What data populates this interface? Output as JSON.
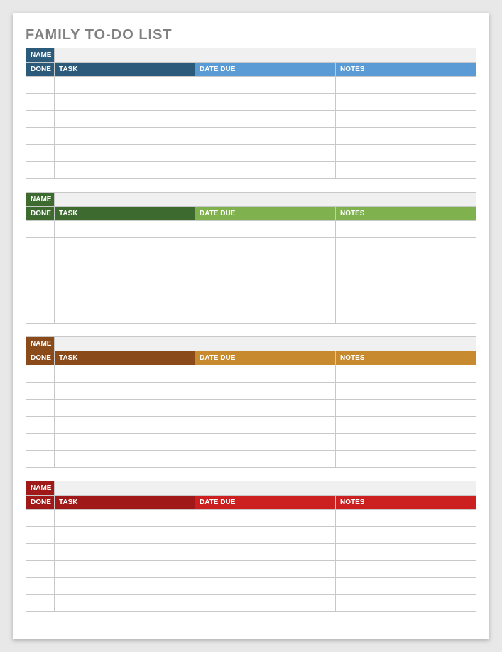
{
  "title": "FAMILY TO-DO LIST",
  "labels": {
    "name": "NAME",
    "done": "DONE",
    "task": "TASK",
    "date_due": "DATE DUE",
    "notes": "NOTES"
  },
  "sections": [
    {
      "name_bg": "#2b5a7a",
      "header_left_bg": "#2b5a7a",
      "header_right_bg": "#5a9bd5",
      "rows": 6
    },
    {
      "name_bg": "#3d6b2f",
      "header_left_bg": "#3d6b2f",
      "header_right_bg": "#7fb24f",
      "rows": 6
    },
    {
      "name_bg": "#8a4a1a",
      "header_left_bg": "#8a4a1a",
      "header_right_bg": "#c78a2e",
      "rows": 6
    },
    {
      "name_bg": "#a01818",
      "header_left_bg": "#a01818",
      "header_right_bg": "#cc1f1f",
      "rows": 6
    }
  ]
}
